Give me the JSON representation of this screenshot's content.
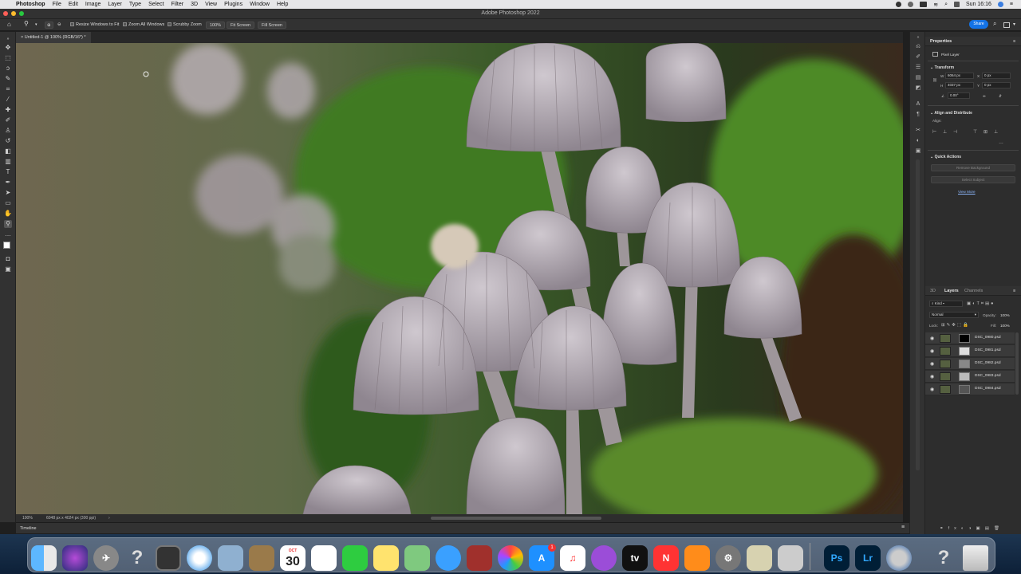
{
  "menubar": {
    "app_name": "Photoshop",
    "items": [
      "File",
      "Edit",
      "Image",
      "Layer",
      "Type",
      "Select",
      "Filter",
      "3D",
      "View",
      "Plugins",
      "Window",
      "Help"
    ],
    "clock": "Sun 16:16"
  },
  "window": {
    "title": "Adobe Photoshop 2022"
  },
  "options": {
    "resize_windows": "Resize Windows to Fit",
    "zoom_all": "Zoom All Windows",
    "scrubby": "Scrubby Zoom",
    "zoom_value": "100%",
    "fit_screen": "Fit Screen",
    "fill_screen": "Fill Screen",
    "share": "Share"
  },
  "document": {
    "tab_title": "Untitled-1 @ 100% (RGB/16*) *"
  },
  "status": {
    "zoom": "100%",
    "dimensions": "6048 px x 4024 px (300 ppi)"
  },
  "timeline": {
    "label": "Timeline"
  },
  "properties": {
    "panel_title": "Properties",
    "layer_type": "Pixel Layer",
    "transform_title": "Transform",
    "w_label": "W",
    "w_value": "6064 px",
    "x_label": "X",
    "x_value": "0 px",
    "h_label": "H",
    "h_value": "4037 px",
    "y_label": "Y",
    "y_value": "0 px",
    "angle_value": "0.00°",
    "align_title": "Align and Distribute",
    "align_label": "Align:",
    "quick_actions_title": "Quick Actions",
    "remove_bg": "Remove Background",
    "select_subject": "Select Subject",
    "view_more": "View More"
  },
  "layers": {
    "tabs": [
      "3D",
      "Layers",
      "Channels"
    ],
    "kind": "Kind",
    "blend_mode": "Normal",
    "opacity_label": "Opacity:",
    "opacity_value": "100%",
    "lock_label": "Lock:",
    "fill_label": "Fill:",
    "fill_value": "100%",
    "items": [
      {
        "name": "DSC_0980.psd"
      },
      {
        "name": "DSC_0981.psd"
      },
      {
        "name": "DSC_0982.psd"
      },
      {
        "name": "DSC_0983.psd"
      },
      {
        "name": "DSC_0984.psd"
      }
    ]
  },
  "dock": {
    "calendar_month": "OCT",
    "calendar_day": "30",
    "appstore_badge": "1",
    "ps_label": "Ps",
    "lr_label": "Lr",
    "tv_label": "tv"
  },
  "colors": {
    "accent": "#1473e6",
    "panel_bg": "#2d2d2d",
    "chrome_bg": "#323232"
  }
}
